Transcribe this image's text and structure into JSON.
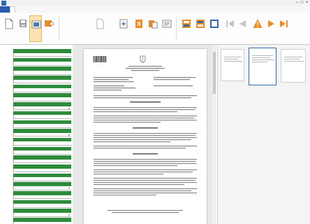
{
  "window": {
    "title": "",
    "controls": [
      "–",
      "□",
      "×"
    ]
  },
  "tabs": [
    {
      "label": ""
    },
    {
      "label": ""
    },
    {
      "label": ""
    },
    {
      "label": ""
    },
    {
      "label": ""
    },
    {
      "label": ""
    },
    {
      "label": ""
    }
  ],
  "ribbon": {
    "buttons": [
      {
        "icon": "document-icon",
        "label": ""
      },
      {
        "icon": "save-icon",
        "label": ""
      },
      {
        "icon": "scan-icon",
        "label": ""
      },
      {
        "icon": "image-settings-icon",
        "label": ""
      },
      {
        "icon": "blank-page-icon",
        "label": ""
      },
      {
        "icon": "export-icon",
        "label": ""
      },
      {
        "icon": "close-document-icon",
        "label": ""
      },
      {
        "icon": "rotate-icon",
        "label": ""
      },
      {
        "icon": "form-icon",
        "label": ""
      },
      {
        "icon": "office-icon",
        "label": ""
      },
      {
        "icon": "pages-icon",
        "label": ""
      },
      {
        "icon": "split-icon",
        "label": ""
      },
      {
        "icon": "first-page-icon",
        "label": ""
      },
      {
        "icon": "previous-page-icon",
        "label": ""
      },
      {
        "icon": "warning-icon",
        "label": ""
      },
      {
        "icon": "next-page-icon",
        "label": ""
      },
      {
        "icon": "last-page-icon",
        "label": ""
      }
    ]
  },
  "fields": [
    {
      "label": "",
      "value": ""
    },
    {
      "label": "",
      "value": ""
    },
    {
      "label": "",
      "value": ""
    },
    {
      "label": "",
      "value": ""
    },
    {
      "label": "",
      "value": ""
    },
    {
      "label": "",
      "value": ""
    },
    {
      "label": "",
      "value": ""
    },
    {
      "label": "",
      "value": ""
    },
    {
      "label": "",
      "value": ""
    },
    {
      "label": "",
      "value": ""
    },
    {
      "label": "",
      "value": ""
    },
    {
      "label": "",
      "value": ""
    },
    {
      "label": "",
      "value": ""
    },
    {
      "label": "",
      "value": ""
    },
    {
      "label": "",
      "value": ""
    },
    {
      "label": "",
      "value": ""
    },
    {
      "label": "",
      "value": ""
    },
    {
      "label": "",
      "value": ""
    },
    {
      "label": "",
      "value": ""
    },
    {
      "label": "",
      "value": ""
    },
    {
      "label": "",
      "value": ""
    }
  ],
  "document": {
    "page_stamp": "",
    "section_heading": ""
  },
  "thumbnails": [
    {
      "label": ""
    },
    {
      "label": ""
    },
    {
      "label": ""
    }
  ],
  "colors": {
    "field_label_green": "#2e8b3b",
    "file_tab_blue": "#2a5db0",
    "accent_orange": "#f08a24",
    "accent_blue": "#2b6cb0",
    "nav_arrow_grey": "#c4c4c4"
  }
}
